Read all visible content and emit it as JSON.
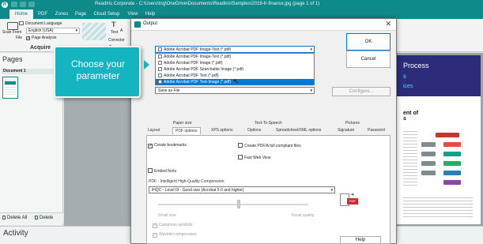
{
  "app": {
    "title": "Readiris Corporate - C:\\Users\\tng\\OneDrive\\Documents\\Readiris\\Samples\\2019-fr-finance.jpg (page 1 of 1)",
    "logo_letter": "R"
  },
  "menu": {
    "tabs": [
      "Home",
      "PDF",
      "Zones",
      "Page",
      "Cloud Setup",
      "View",
      "Help"
    ],
    "active": "Home"
  },
  "ribbon": {
    "scan_label": "Scan From",
    "file_label": "File",
    "doc_language_label": "Document Language",
    "language_value": "English (USA)",
    "page_analysis_label": "Page Analysis",
    "acquire_label": "Acquire",
    "text_label": "Text",
    "corrector_label": "Corrector",
    "to_label": "To",
    "a_label": "A"
  },
  "pages_panel": {
    "header": "Pages",
    "document_label": "Document 1",
    "delete_all_label": "Delete All",
    "delete_label": "Delete"
  },
  "activity": {
    "label": "Activity"
  },
  "callout": {
    "line1": "Choose your",
    "line2": "parameter"
  },
  "right_doc": {
    "hero_line1": "Process",
    "hero_line2": "s",
    "hero_line3": "ices",
    "heading_line1": "ent of",
    "heading_line2": "s"
  },
  "dialog": {
    "title": "Output",
    "format_selected": "Adobe Acrobat PDF Image-Text (*.pdf)",
    "format_options": [
      "Adobe Acrobat PDF Image-Text (*.pdf)",
      "Adobe Acrobat PDF Image (*.pdf)",
      "Adobe Acrobat PDF Searchable Image (*.pdf)",
      "Adobe Acrobat PDF Text (*.pdf)",
      "Adobe Acrobat PDF Text-Image (*.pdf)"
    ],
    "selected_option_index": 4,
    "save_target": "Save as File",
    "ok_label": "OK",
    "cancel_label": "Cancel",
    "configure_label": "Configure...",
    "help_label": "Help",
    "tabs_top": [
      "Paper size",
      "Text-To-Speech",
      "Pictures"
    ],
    "tabs_bottom": [
      "Layout",
      "PDF options",
      "XPS options",
      "Options",
      "Spreadsheet/XML options",
      "Signature",
      "Password"
    ],
    "active_tab": "PDF options",
    "create_bookmarks": {
      "label": "Create bookmarks",
      "checked": true
    },
    "create_pdfa": {
      "label": "Create PDF/A full compliant files",
      "checked": false
    },
    "fast_web_view": {
      "label": "Fast Web View",
      "checked": false
    },
    "embed_fonts": {
      "label": "Embed fonts",
      "checked": false
    },
    "ihqc_section": "PDF - Intelligent High-Quality Compression",
    "ihqc_value": "iHQC - Level III - Good size (Acrobat 5.0 and higher)",
    "small_size_label": "Small size",
    "visual_quality_label": "Visual quality",
    "compress_symbols": {
      "label": "Compress symbols",
      "checked": true
    },
    "wavelet_compression": {
      "label": "Wavelet compression",
      "checked": true
    },
    "pdf_badge": "PDF"
  },
  "colors": {
    "brand_teal": "#0f8a8a",
    "callout_teal": "#14b4c0",
    "selection_blue": "#0078d7",
    "doc_navy": "#2c2c7a"
  }
}
